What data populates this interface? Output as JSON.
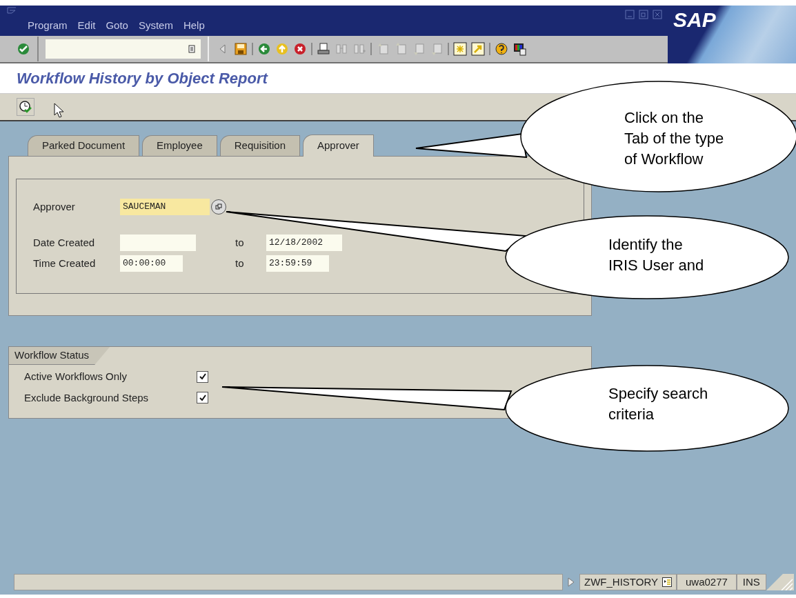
{
  "menu": [
    "Program",
    "Edit",
    "Goto",
    "System",
    "Help"
  ],
  "logo": "SAP",
  "title": "Workflow History by Object Report",
  "tabs": [
    {
      "label": "Parked Document",
      "selected": false
    },
    {
      "label": "Employee",
      "selected": false
    },
    {
      "label": "Requisition",
      "selected": false
    },
    {
      "label": "Approver",
      "selected": true
    }
  ],
  "selection": {
    "approver": {
      "label": "Approver",
      "value": "SAUCEMAN"
    },
    "date_created": {
      "label": "Date Created",
      "to": "to",
      "high": "12/18/2002"
    },
    "time_created": {
      "label": "Time Created",
      "low": "00:00:00",
      "to": "to",
      "high": "23:59:59"
    }
  },
  "workflow_status": {
    "title": "Workflow Status",
    "options": [
      {
        "label": "Active Workflows Only",
        "checked": true
      },
      {
        "label": "Exclude Background Steps",
        "checked": true
      }
    ]
  },
  "status_bar": {
    "transaction": "ZWF_HISTORY",
    "user": "uwa0277",
    "mode": "INS"
  },
  "callouts": [
    {
      "lines": [
        "Click on the",
        "Tab of the type",
        "of Workflow"
      ]
    },
    {
      "lines": [
        "Identify the",
        "IRIS User and"
      ]
    },
    {
      "lines": [
        "Specify search",
        "criteria"
      ]
    }
  ]
}
